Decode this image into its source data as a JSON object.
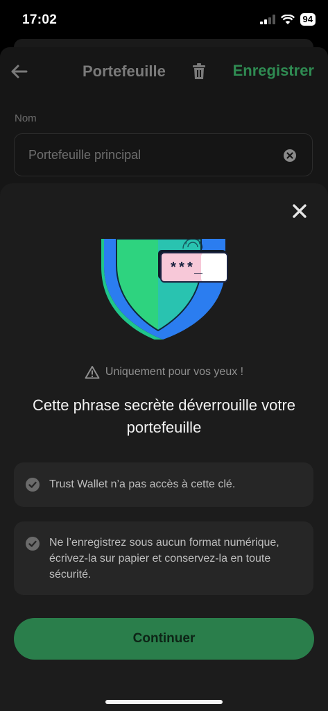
{
  "status_bar": {
    "time": "17:02",
    "battery": "94"
  },
  "header": {
    "title": "Portefeuille",
    "save_label": "Enregistrer"
  },
  "form": {
    "name_label": "Nom",
    "name_value": "Portefeuille principal"
  },
  "sheet": {
    "password_mask": "***_",
    "warning": "Uniquement pour vos yeux !",
    "headline": "Cette phrase secrète déverrouille votre portefeuille",
    "points": [
      "Trust Wallet n’a pas accès à cette clé.",
      "Ne l’enregistrez sous aucun format numérique, écrivez-la sur papier et conservez-la en toute sécurité."
    ],
    "continue_label": "Continuer"
  },
  "colors": {
    "accent": "#2f8b52",
    "button": "#2a7e4b",
    "sheet_bg": "#1c1c1c",
    "card_bg": "#262626"
  },
  "icons": [
    "back-arrow-icon",
    "trash-icon",
    "clear-icon",
    "close-icon",
    "warning-icon",
    "check-circle-icon",
    "signal-icon",
    "wifi-icon",
    "battery-icon"
  ]
}
